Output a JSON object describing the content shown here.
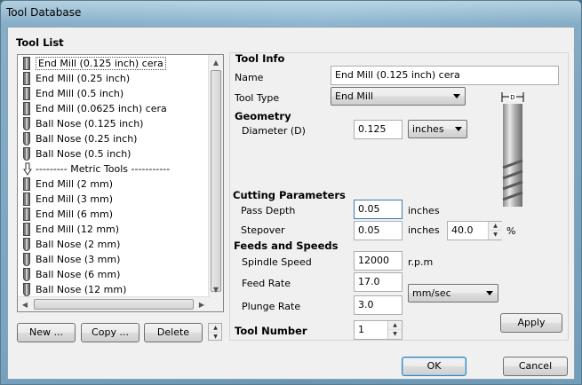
{
  "window": {
    "title": "Tool Database"
  },
  "tool_list": {
    "heading": "Tool List",
    "items": [
      {
        "label": "End Mill (0.125 inch) cera",
        "icon": "end-mill-icon",
        "selected": true
      },
      {
        "label": "End Mill (0.25 inch)",
        "icon": "end-mill-icon"
      },
      {
        "label": "End Mill (0.5 inch)",
        "icon": "end-mill-icon"
      },
      {
        "label": "End Mill (0.0625 inch) cera",
        "icon": "end-mill-icon"
      },
      {
        "label": "Ball Nose (0.125 inch)",
        "icon": "ball-nose-icon"
      },
      {
        "label": "Ball Nose (0.25 inch)",
        "icon": "ball-nose-icon"
      },
      {
        "label": "Ball Nose (0.5 inch)",
        "icon": "ball-nose-icon"
      },
      {
        "label": "--------- Metric Tools -----------",
        "icon": "group-arrow-icon"
      },
      {
        "label": "End Mill (2 mm)",
        "icon": "end-mill-icon"
      },
      {
        "label": "End Mill (3 mm)",
        "icon": "end-mill-icon"
      },
      {
        "label": "End Mill (6 mm)",
        "icon": "end-mill-icon"
      },
      {
        "label": "End Mill (12 mm)",
        "icon": "end-mill-icon"
      },
      {
        "label": "Ball Nose (2 mm)",
        "icon": "ball-nose-icon"
      },
      {
        "label": "Ball Nose (3 mm)",
        "icon": "ball-nose-icon"
      },
      {
        "label": "Ball Nose (6 mm)",
        "icon": "ball-nose-icon"
      },
      {
        "label": "Ball Nose (12 mm)",
        "icon": "ball-nose-icon"
      }
    ],
    "new_label": "New ...",
    "copy_label": "Copy ...",
    "delete_label": "Delete"
  },
  "tool_info": {
    "heading": "Tool Info",
    "name_label": "Name",
    "name_value": "End Mill (0.125 inch) cera",
    "tool_type_label": "Tool Type",
    "tool_type_value": "End Mill",
    "geometry_heading": "Geometry",
    "diameter_label": "Diameter (D)",
    "diameter_value": "0.125",
    "diameter_units": "inches",
    "diagram_label": "D"
  },
  "cutting": {
    "heading": "Cutting Parameters",
    "pass_depth_label": "Pass Depth",
    "pass_depth_value": "0.05",
    "pass_depth_units": "inches",
    "stepover_label": "Stepover",
    "stepover_value": "0.05",
    "stepover_units": "inches",
    "stepover_percent": "40.0",
    "percent_sign": "%"
  },
  "feeds": {
    "heading": "Feeds and Speeds",
    "spindle_label": "Spindle Speed",
    "spindle_value": "12000",
    "spindle_units": "r.p.m",
    "feed_label": "Feed Rate",
    "feed_value": "17.0",
    "rate_units": "mm/sec",
    "plunge_label": "Plunge Rate",
    "plunge_value": "3.0"
  },
  "tool_number": {
    "label": "Tool Number",
    "value": "1"
  },
  "buttons": {
    "apply": "Apply",
    "ok": "OK",
    "cancel": "Cancel"
  }
}
